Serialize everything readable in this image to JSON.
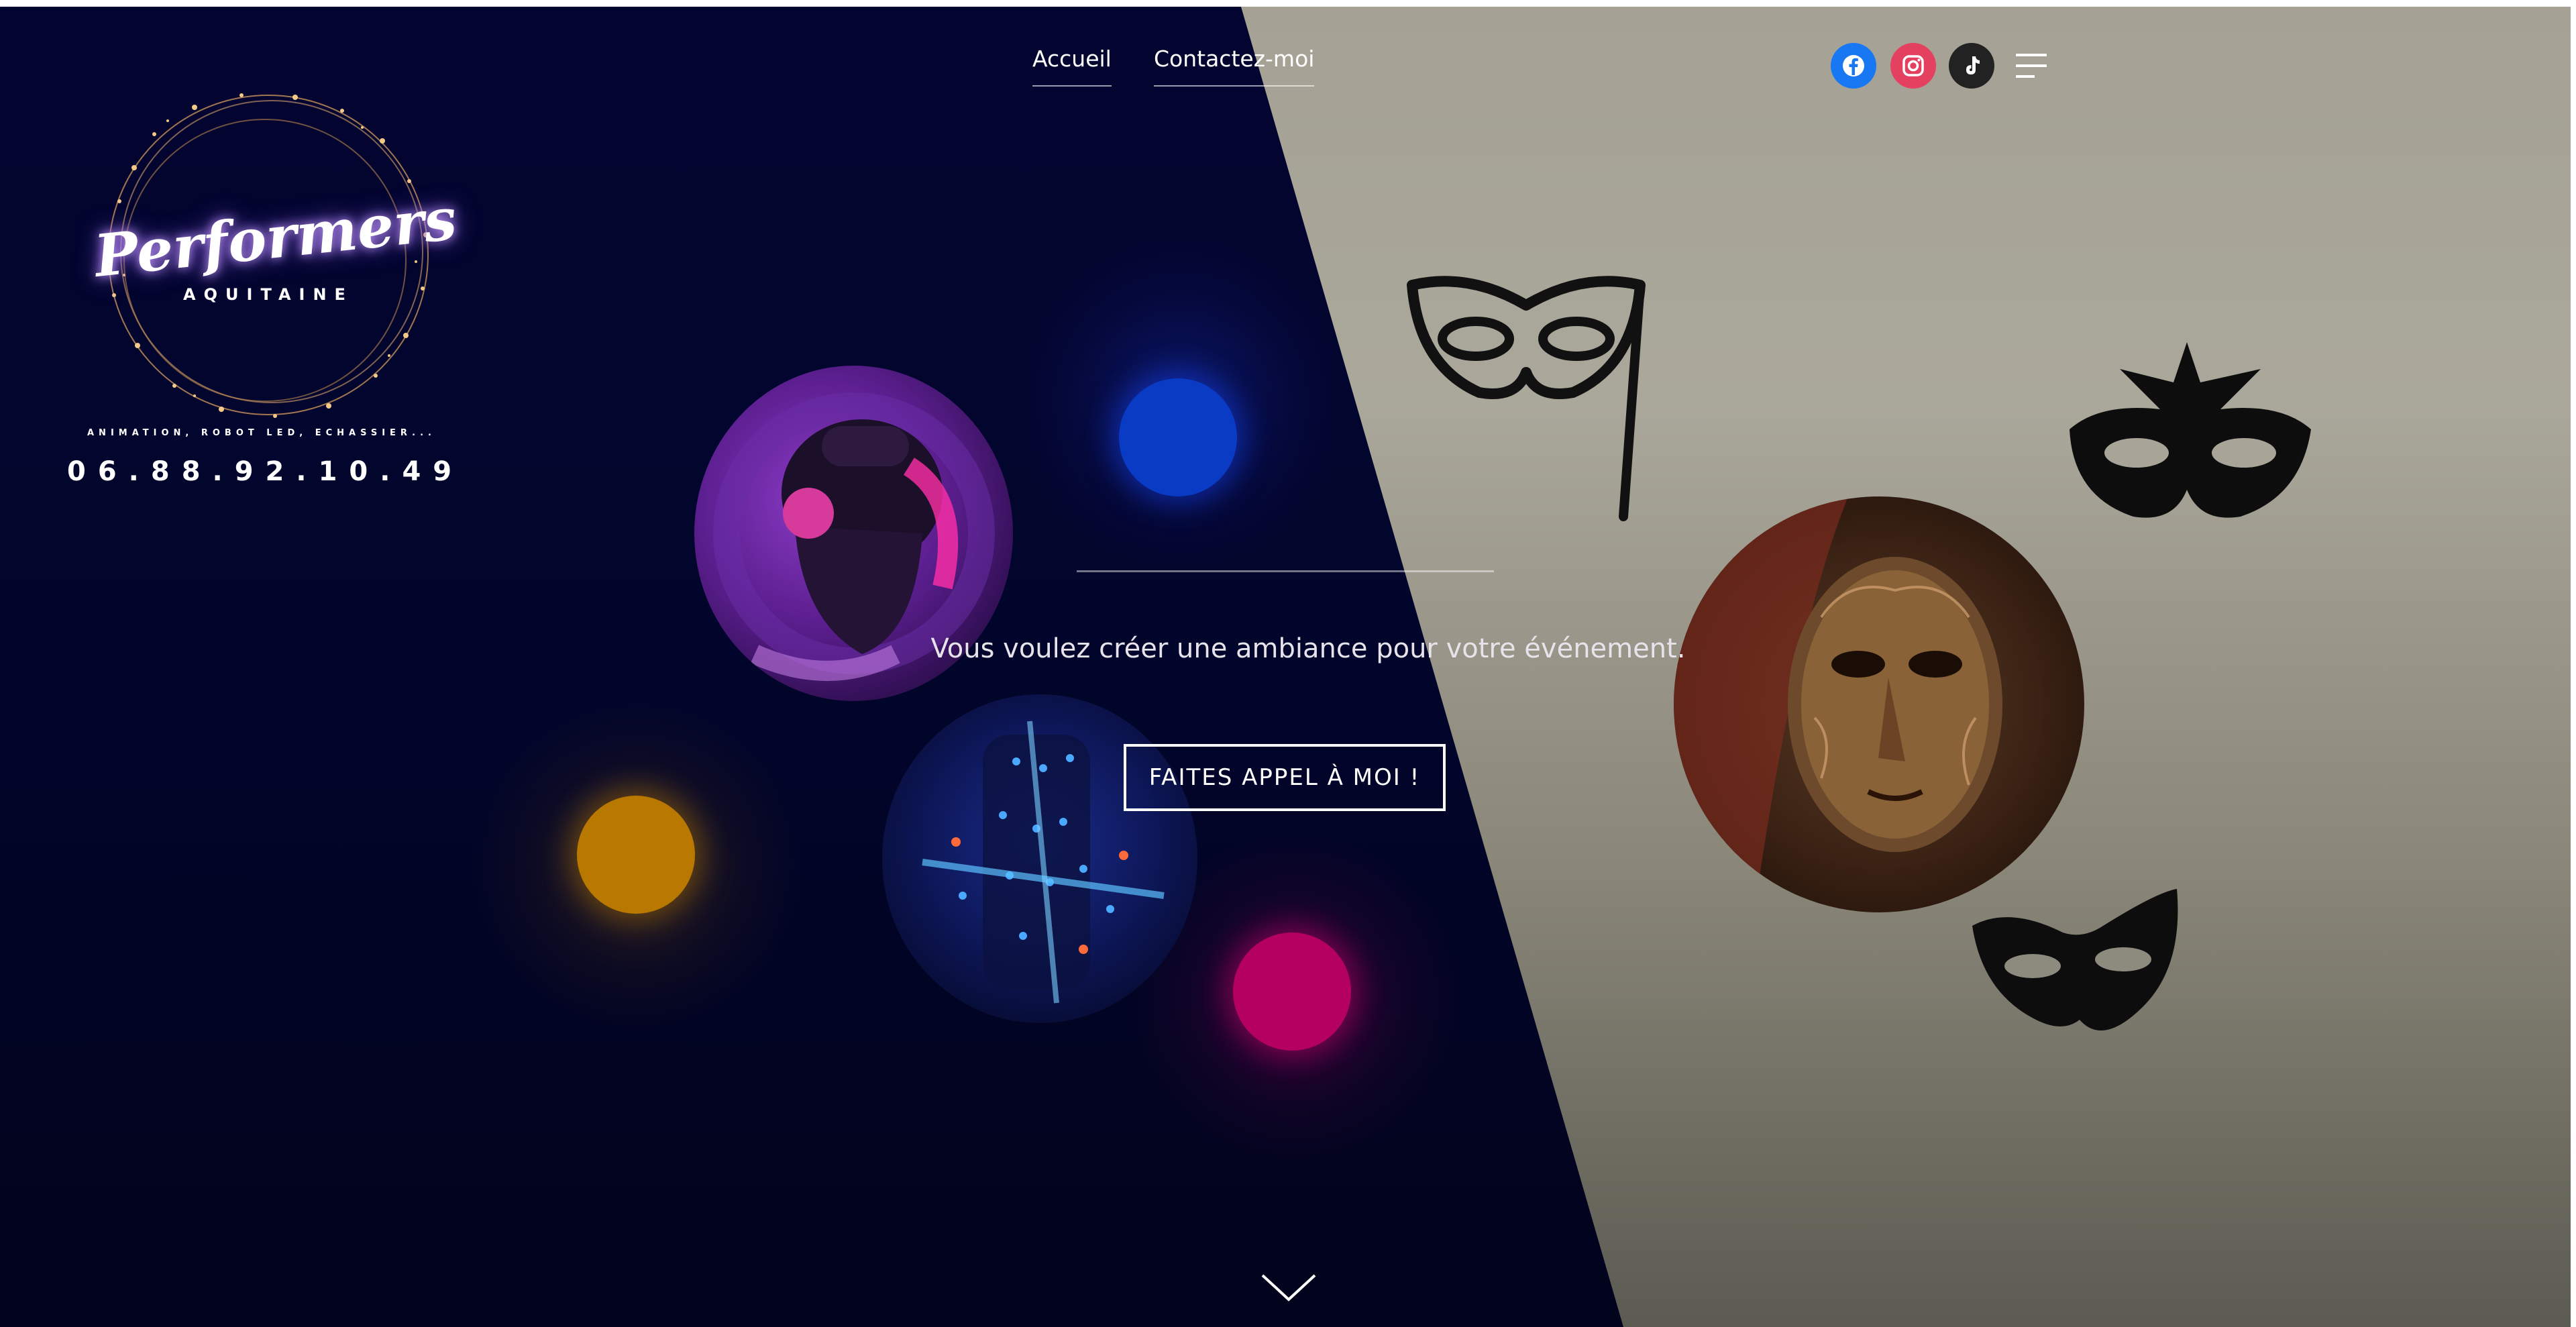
{
  "nav": {
    "links": [
      {
        "label": "Accueil"
      },
      {
        "label": "Contactez-moi"
      }
    ],
    "social": [
      {
        "name": "facebook-icon",
        "color": "#1877f2"
      },
      {
        "name": "instagram-icon",
        "color": "#e4405f"
      },
      {
        "name": "tiktok-icon",
        "color": "#222222"
      }
    ],
    "menu_icon": "hamburger-menu-icon"
  },
  "logo": {
    "title": "Performers",
    "subtitle": "AQUITAINE",
    "tagline": "ANIMATION, ROBOT LED, ECHASSIER...",
    "phone": "06.88.92.10.49"
  },
  "hero": {
    "headline": "Vous voulez créer une ambiance pour votre événement.",
    "cta_label": "FAITES APPEL À MOI !",
    "scroll_icon": "chevron-down-icon"
  },
  "colors": {
    "dark_bg": "#030531",
    "light_bg": "#a5a295",
    "dot_blue": "#0a3bc4",
    "dot_orange": "#b97800",
    "dot_magenta": "#b30061"
  }
}
